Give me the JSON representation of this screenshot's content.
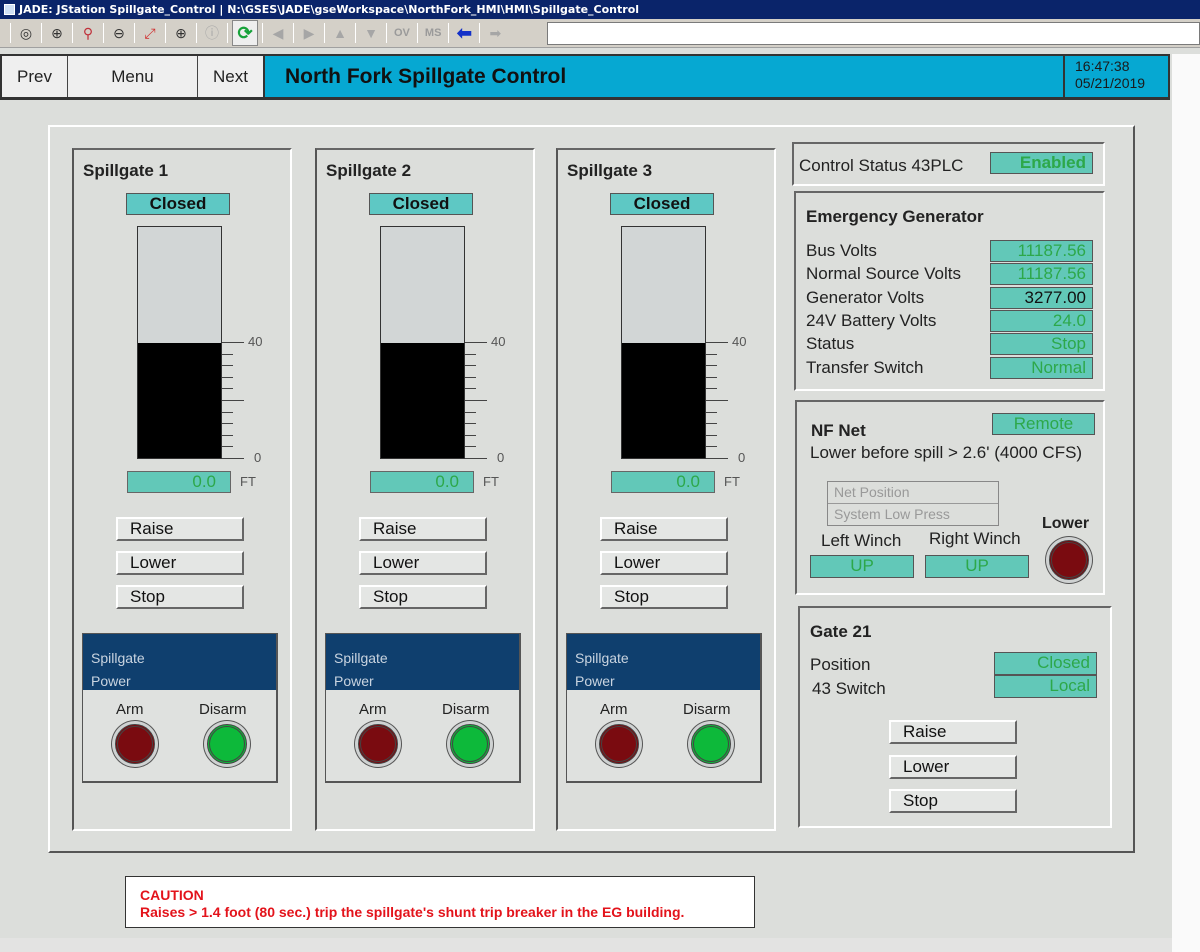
{
  "window": {
    "title": "JADE: JStation  Spillgate_Control | N:\\GSES\\JADE\\gseWorkspace\\NorthFork_HMI\\HMI\\Spillgate_Control"
  },
  "toolbar": {
    "buttons": [
      {
        "icon": "target-icon",
        "glyph": "◎"
      },
      {
        "icon": "zoom-in-icon",
        "glyph": "⊕"
      },
      {
        "icon": "find-icon",
        "glyph": "⚲"
      },
      {
        "icon": "zoom-out-icon",
        "glyph": "⊖"
      },
      {
        "icon": "fit-window-icon",
        "glyph": "⤢"
      },
      {
        "icon": "zoom-icon",
        "glyph": "⊕"
      },
      {
        "icon": "info-icon",
        "glyph": "ⓘ"
      },
      {
        "icon": "refresh-icon",
        "glyph": "⟳"
      },
      {
        "icon": "arrow-left-icon",
        "glyph": "◀"
      },
      {
        "icon": "arrow-right-icon",
        "glyph": "▶"
      },
      {
        "icon": "arrow-up-icon",
        "glyph": "▲"
      },
      {
        "icon": "arrow-down-icon",
        "glyph": "▼"
      },
      {
        "icon": "back-icon",
        "glyph": "⬅"
      },
      {
        "icon": "forward-icon",
        "glyph": "➡"
      }
    ],
    "ov_label": "OV",
    "ms_label": "MS"
  },
  "nav": {
    "prev_label": "Prev",
    "menu_label": "Menu",
    "next_label": "Next",
    "page_title": "North Fork Spillgate Control",
    "time": "16:47:38",
    "date": "05/21/2019"
  },
  "spillgates": [
    {
      "title": "Spillgate 1",
      "status": "Closed",
      "level_ft": "0.0",
      "unit": "FT",
      "fill_fraction": 0.5,
      "scale_max": "40",
      "scale_min": "0",
      "raise_label": "Raise",
      "lower_label": "Lower",
      "stop_label": "Stop",
      "power_title_1": "Spillgate",
      "power_title_2": "Power",
      "arm_label": "Arm",
      "disarm_label": "Disarm"
    },
    {
      "title": "Spillgate 2",
      "status": "Closed",
      "level_ft": "0.0",
      "unit": "FT",
      "fill_fraction": 0.5,
      "scale_max": "40",
      "scale_min": "0",
      "raise_label": "Raise",
      "lower_label": "Lower",
      "stop_label": "Stop",
      "power_title_1": "Spillgate",
      "power_title_2": "Power",
      "arm_label": "Arm",
      "disarm_label": "Disarm"
    },
    {
      "title": "Spillgate 3",
      "status": "Closed",
      "level_ft": "0.0",
      "unit": "FT",
      "fill_fraction": 0.5,
      "scale_max": "40",
      "scale_min": "0",
      "raise_label": "Raise",
      "lower_label": "Lower",
      "stop_label": "Stop",
      "power_title_1": "Spillgate",
      "power_title_2": "Power",
      "arm_label": "Arm",
      "disarm_label": "Disarm"
    }
  ],
  "control_status": {
    "label": "Control Status 43PLC",
    "value": "Enabled"
  },
  "emergency_generator": {
    "title": "Emergency Generator",
    "rows": [
      {
        "label": "Bus Volts",
        "value": "11187.56"
      },
      {
        "label": "Normal Source Volts",
        "value": "11187.56"
      },
      {
        "label": "Generator Volts",
        "value": "3277.00"
      },
      {
        "label": "24V Battery Volts",
        "value": "24.0"
      },
      {
        "label": "Status",
        "value": "Stop"
      },
      {
        "label": "Transfer Switch",
        "value": "Normal"
      }
    ]
  },
  "nf_net": {
    "title": "NF Net",
    "mode": "Remote",
    "note": "Lower before spill > 2.6' (4000 CFS)",
    "alarms": [
      "Net Position",
      "System Low Press"
    ],
    "left_winch_label": "Left Winch",
    "left_winch_value": "UP",
    "right_winch_label": "Right Winch",
    "right_winch_value": "UP",
    "lower_label": "Lower"
  },
  "gate21": {
    "title": "Gate 21",
    "position_label": "Position",
    "position_value": "Closed",
    "switch_label": "43 Switch",
    "switch_value": "Local",
    "raise_label": "Raise",
    "lower_label": "Lower",
    "stop_label": "Stop"
  },
  "caution": {
    "title": "CAUTION",
    "message": "Raises > 1.4 foot (80 sec.) trip the spillgate's shunt trip breaker in the EG building."
  }
}
